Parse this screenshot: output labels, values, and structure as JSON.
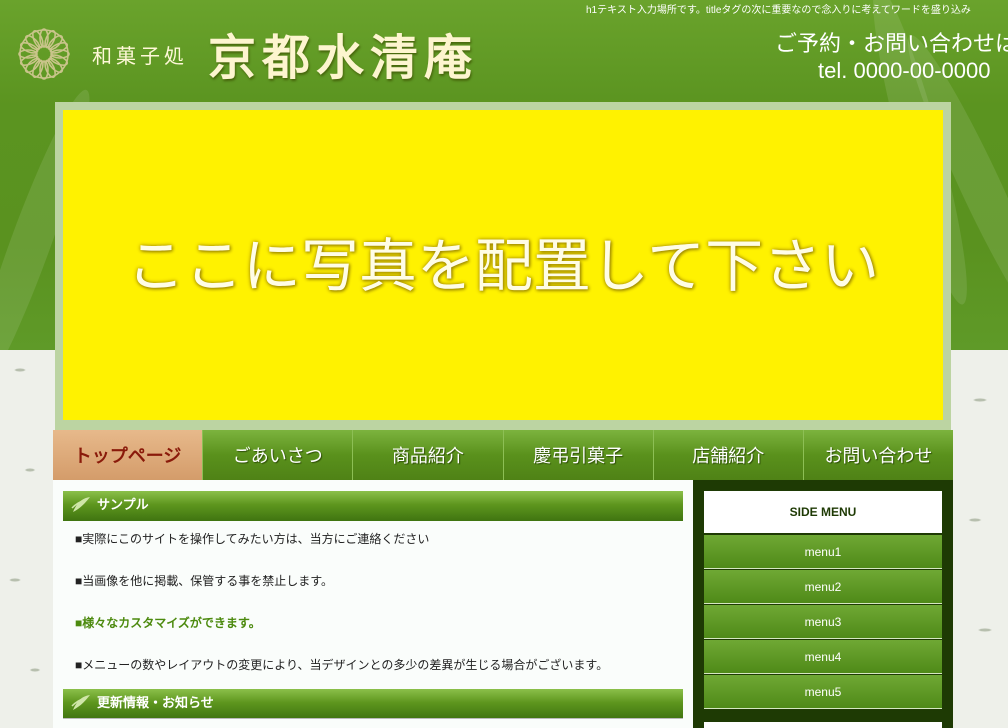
{
  "header": {
    "h1_text": "h1テキスト入力場所です。titleタグの次に重要なので念入りに考えてワードを盛り込み",
    "logo_small": "和菓子処",
    "logo_main": "京都水清庵",
    "contact_label": "ご予約・お問い合わせは",
    "contact_tel": "tel. 0000-00-0000"
  },
  "hero": {
    "text": "ここに写真を配置して下さい",
    "background": "#fff200"
  },
  "nav": {
    "items": [
      {
        "label": "トップページ"
      },
      {
        "label": "ごあいさつ"
      },
      {
        "label": "商品紹介"
      },
      {
        "label": "慶弔引菓子"
      },
      {
        "label": "店舗紹介"
      },
      {
        "label": "お問い合わせ"
      }
    ]
  },
  "main": {
    "sample_title": "サンプル",
    "lines": [
      "■実際にこのサイトを操作してみたい方は、当方にご連絡ください",
      "■当画像を他に掲載、保管する事を禁止します。",
      "■様々なカスタマイズができます。",
      "■メニューの数やレイアウトの変更により、当デザインとの多少の差異が生じる場合がございます。"
    ],
    "news_title": "更新情報・お知らせ"
  },
  "side": {
    "title": "SIDE MENU",
    "items": [
      "menu1",
      "menu2",
      "menu3",
      "menu4",
      "menu5"
    ]
  },
  "colors": {
    "brand_green": "#5a921f",
    "active_tab": "#d49c6a",
    "sidebar_bg": "#1e3a04"
  }
}
